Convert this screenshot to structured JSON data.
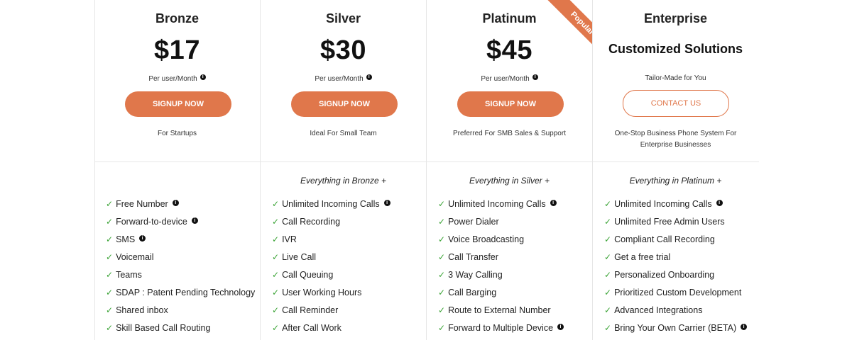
{
  "plans": [
    {
      "name": "Bronze",
      "price": "$17",
      "per": "Per user/Month",
      "button": "SIGNUP NOW",
      "tagline": "For Startups",
      "everything": "",
      "features": [
        {
          "label": "Free Number",
          "info": true
        },
        {
          "label": "Forward-to-device",
          "info": true
        },
        {
          "label": "SMS",
          "info": true
        },
        {
          "label": "Voicemail",
          "info": false
        },
        {
          "label": "Teams",
          "info": false
        },
        {
          "label": "SDAP : Patent Pending Technology",
          "info": false
        },
        {
          "label": "Shared inbox",
          "info": false
        },
        {
          "label": "Skill Based Call Routing",
          "info": false
        }
      ]
    },
    {
      "name": "Silver",
      "price": "$30",
      "per": "Per user/Month",
      "button": "SIGNUP NOW",
      "tagline": "Ideal For Small Team",
      "everything": "Everything in Bronze +",
      "features": [
        {
          "label": "Unlimited Incoming Calls",
          "info": true
        },
        {
          "label": "Call Recording",
          "info": false
        },
        {
          "label": "IVR",
          "info": false
        },
        {
          "label": "Live Call",
          "info": false
        },
        {
          "label": "Call Queuing",
          "info": false
        },
        {
          "label": "User Working Hours",
          "info": false
        },
        {
          "label": "Call Reminder",
          "info": false
        },
        {
          "label": "After Call Work",
          "info": false
        }
      ]
    },
    {
      "name": "Platinum",
      "price": "$45",
      "per": "Per user/Month",
      "button": "SIGNUP NOW",
      "tagline": "Preferred For SMB Sales & Support",
      "badge": "Popular",
      "everything": "Everything in Silver +",
      "features": [
        {
          "label": "Unlimited Incoming Calls",
          "info": true
        },
        {
          "label": "Power Dialer",
          "info": false
        },
        {
          "label": "Voice Broadcasting",
          "info": false
        },
        {
          "label": "Call Transfer",
          "info": false
        },
        {
          "label": "3 Way Calling",
          "info": false
        },
        {
          "label": "Call Barging",
          "info": false
        },
        {
          "label": "Route to External Number",
          "info": false
        },
        {
          "label": "Forward to Multiple Device",
          "info": true
        }
      ]
    },
    {
      "name": "Enterprise",
      "subtitle": "Customized Solutions",
      "tailor": "Tailor-Made for You",
      "button": "CONTACT US",
      "tagline": "One-Stop Business Phone System For Enterprise Businesses",
      "everything": "Everything in Platinum +",
      "features": [
        {
          "label": "Unlimited Incoming Calls",
          "info": true
        },
        {
          "label": "Unlimited Free Admin Users",
          "info": false
        },
        {
          "label": "Compliant Call Recording",
          "info": false
        },
        {
          "label": "Get a free trial",
          "info": false
        },
        {
          "label": "Personalized Onboarding",
          "info": false
        },
        {
          "label": "Prioritized Custom Development",
          "info": false
        },
        {
          "label": "Advanced Integrations",
          "info": false
        },
        {
          "label": "Bring Your Own Carrier (BETA)",
          "info": true
        }
      ]
    }
  ],
  "icons": {
    "check": "check-icon",
    "info": "info-icon"
  },
  "colors": {
    "accent": "#e0774b",
    "check": "#3aa335",
    "divider": "#e6e6e6"
  }
}
